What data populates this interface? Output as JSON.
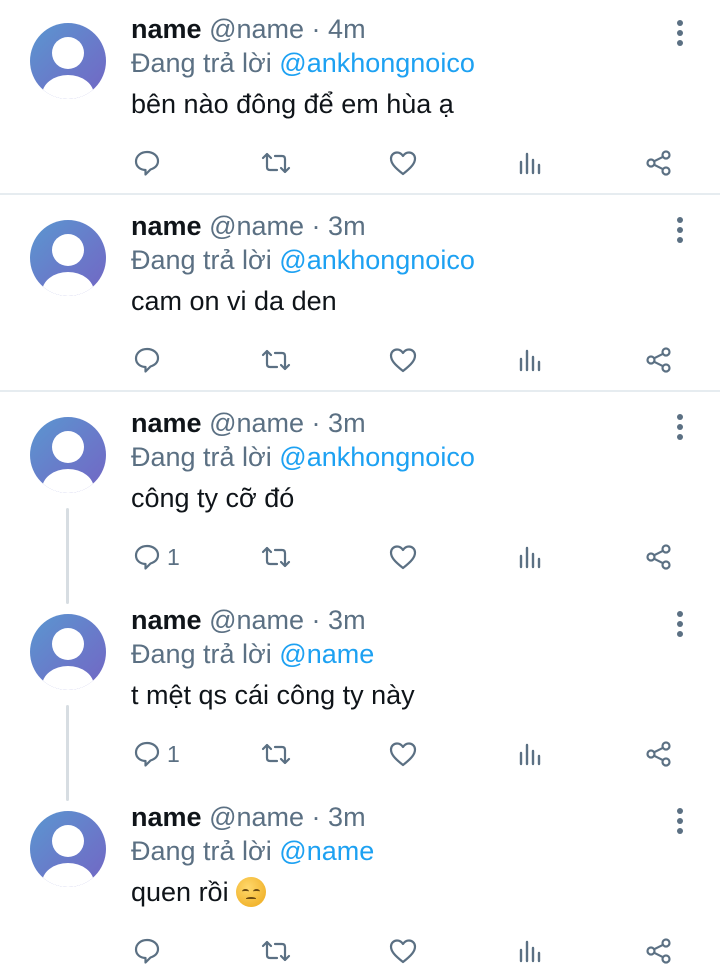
{
  "tweets": [
    {
      "display_name": "name",
      "handle": "@name",
      "separator": "·",
      "time": "4m",
      "reply_prefix": "Đang trả lời",
      "reply_to": "@ankhongnoico",
      "text": "bên nào đông để em hùa ạ",
      "emoji": "",
      "reply_count": "",
      "icons": [
        "reply-icon",
        "retweet-icon",
        "like-icon",
        "analytics-icon",
        "share-icon",
        "more-icon"
      ]
    },
    {
      "display_name": "name",
      "handle": "@name",
      "separator": "·",
      "time": "3m",
      "reply_prefix": "Đang trả lời",
      "reply_to": "@ankhongnoico",
      "text": "cam on vi da den",
      "emoji": "",
      "reply_count": "",
      "icons": [
        "reply-icon",
        "retweet-icon",
        "like-icon",
        "analytics-icon",
        "share-icon",
        "more-icon"
      ]
    },
    {
      "display_name": "name",
      "handle": "@name",
      "separator": "·",
      "time": "3m",
      "reply_prefix": "Đang trả lời",
      "reply_to": "@ankhongnoico",
      "text": "công ty cỡ đó",
      "emoji": "",
      "reply_count": "1",
      "icons": [
        "reply-icon",
        "retweet-icon",
        "like-icon",
        "analytics-icon",
        "share-icon",
        "more-icon"
      ]
    },
    {
      "display_name": "name",
      "handle": "@name",
      "separator": "·",
      "time": "3m",
      "reply_prefix": "Đang trả lời",
      "reply_to": "@name",
      "text": "t mệt qs cái công ty này",
      "emoji": "",
      "reply_count": "1",
      "icons": [
        "reply-icon",
        "retweet-icon",
        "like-icon",
        "analytics-icon",
        "share-icon",
        "more-icon"
      ]
    },
    {
      "display_name": "name",
      "handle": "@name",
      "separator": "·",
      "time": "3m",
      "reply_prefix": "Đang trả lời",
      "reply_to": "@name",
      "text": "quen rồi",
      "emoji": "pensive-face-emoji",
      "reply_count": "",
      "icons": [
        "reply-icon",
        "retweet-icon",
        "like-icon",
        "analytics-icon",
        "share-icon",
        "more-icon"
      ]
    }
  ],
  "colors": {
    "name": "#0f1419",
    "secondary": "#5b7083",
    "mention": "#1da1f2",
    "divider": "#e6ecf0",
    "thread_line": "#d7dde2",
    "avatar_from": "#5a97d0",
    "avatar_to": "#7266c4"
  }
}
